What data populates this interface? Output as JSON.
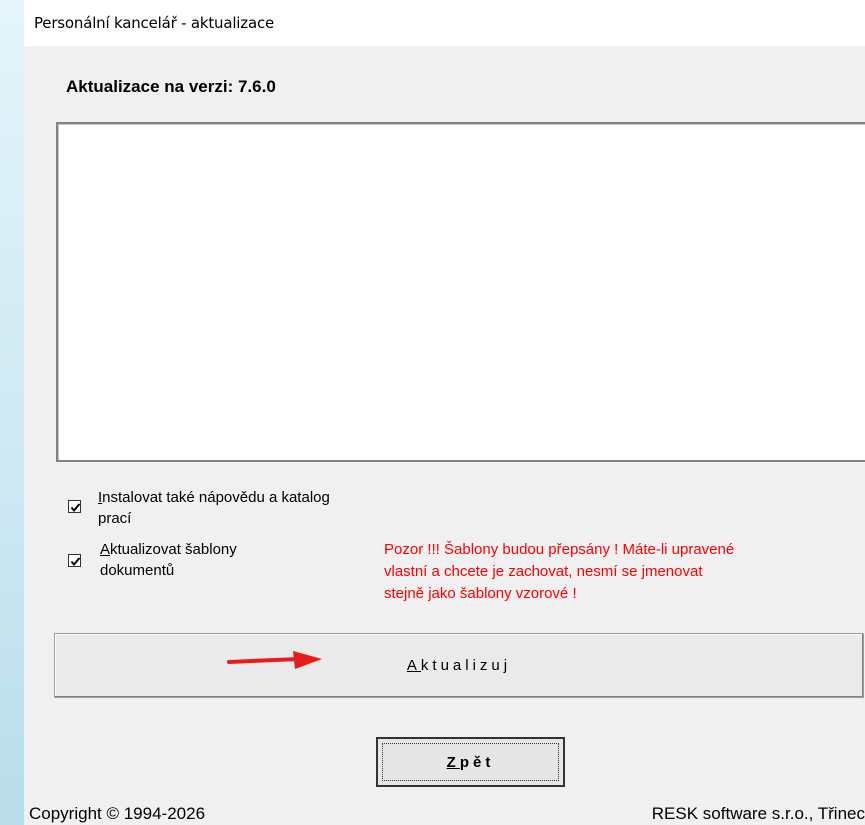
{
  "window": {
    "title": "Personální kancelář - aktualizace"
  },
  "header": {
    "version_label": "Aktualizace na verzi: 7.6.0"
  },
  "notes": {
    "content": ""
  },
  "options": [
    {
      "accel": "I",
      "rest_line1": "nstalovat také nápovědu a katalog",
      "line2": "prací",
      "checked": true
    },
    {
      "accel": "A",
      "rest_line1": "ktualizovat šablony",
      "line2": "dokumentů",
      "checked": true
    }
  ],
  "warning": {
    "line1": "Pozor !!! Šablony budou přepsány ! Máte-li upravené",
    "line2": "vlastní a chcete je zachovat, nesmí se jmenovat",
    "line3": "stejně jako šablony vzorové !"
  },
  "buttons": {
    "update": {
      "accel": "A",
      "rest": "ktualizuj"
    },
    "back": {
      "accel": "Z",
      "rest": "pět"
    }
  },
  "footer": {
    "copyright": "Copyright © 1994-2026",
    "company": "RESK software s.r.o., Třinec"
  },
  "colors": {
    "warning": "#ff0000",
    "arrow": "#e81b1b",
    "window_bg": "#f0f0f0"
  },
  "icons": {
    "arrow": "red-arrow-right-icon",
    "check": "checkmark-icon"
  }
}
